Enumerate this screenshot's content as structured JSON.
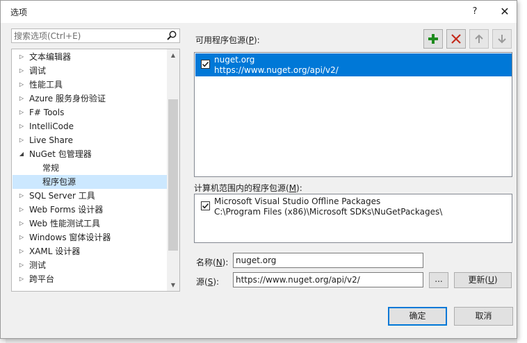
{
  "dialog": {
    "title": "选项",
    "help": "?",
    "close": "✕"
  },
  "search": {
    "placeholder": "搜索选项(Ctrl+E)"
  },
  "tree": {
    "items": [
      {
        "label": "文本编辑器",
        "expandable": true
      },
      {
        "label": "调试",
        "expandable": true
      },
      {
        "label": "性能工具",
        "expandable": true
      },
      {
        "label": "Azure 服务身份验证",
        "expandable": true
      },
      {
        "label": "F# Tools",
        "expandable": true
      },
      {
        "label": "IntelliCode",
        "expandable": true
      },
      {
        "label": "Live Share",
        "expandable": true
      },
      {
        "label": "NuGet 包管理器",
        "expandable": true,
        "expanded": true
      },
      {
        "label": "常规",
        "child": true
      },
      {
        "label": "程序包源",
        "child": true,
        "selected": true
      },
      {
        "label": "SQL Server 工具",
        "expandable": true
      },
      {
        "label": "Web Forms 设计器",
        "expandable": true
      },
      {
        "label": "Web 性能测试工具",
        "expandable": true
      },
      {
        "label": "Windows 窗体设计器",
        "expandable": true
      },
      {
        "label": "XAML 设计器",
        "expandable": true
      },
      {
        "label": "测试",
        "expandable": true
      },
      {
        "label": "跨平台",
        "expandable": true
      }
    ]
  },
  "available_sources": {
    "label_pre": "可用程序包源(",
    "label_key": "P",
    "label_post": "):",
    "items": [
      {
        "name": "nuget.org",
        "url": "https://www.nuget.org/api/v2/",
        "checked": true,
        "selected": true
      }
    ]
  },
  "machine_sources": {
    "label_pre": "计算机范围内的程序包源(",
    "label_key": "M",
    "label_post": "):",
    "items": [
      {
        "name": "Microsoft Visual Studio Offline Packages",
        "url": "C:\\Program Files (x86)\\Microsoft SDKs\\NuGetPackages\\",
        "checked": true
      }
    ]
  },
  "form": {
    "name_label_pre": "名称(",
    "name_label_key": "N",
    "name_label_post": "):",
    "name_value": "nuget.org",
    "source_label_pre": "源(",
    "source_label_key": "S",
    "source_label_post": "):",
    "source_value": "https://www.nuget.org/api/v2/",
    "browse_label": "...",
    "update_label_pre": "更新(",
    "update_label_key": "U",
    "update_label_post": ")"
  },
  "buttons": {
    "ok": "确定",
    "cancel": "取消"
  },
  "colors": {
    "add": "#1e8b1e",
    "remove": "#c42b1c",
    "selection": "#0078d7"
  }
}
